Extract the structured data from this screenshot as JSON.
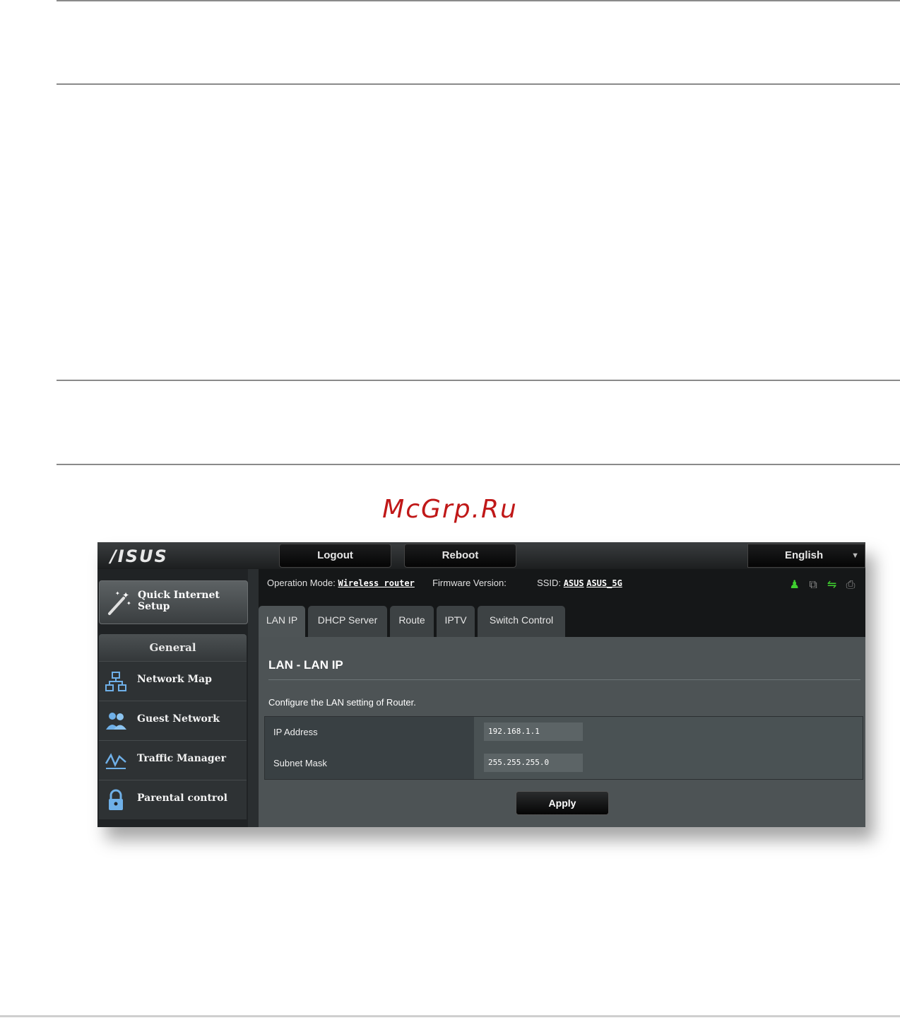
{
  "watermark": "McGrp.Ru",
  "router": {
    "logo": "/ISUS",
    "buttons": {
      "logout": "Logout",
      "reboot": "Reboot"
    },
    "language": "English",
    "sidebar": {
      "quick_setup": "Quick Internet Setup",
      "section": "General",
      "items": [
        {
          "label": "Network Map",
          "icon": "network-map-icon"
        },
        {
          "label": "Guest Network",
          "icon": "guest-network-icon"
        },
        {
          "label": "Traffic Manager",
          "icon": "traffic-manager-icon"
        },
        {
          "label": "Parental control",
          "icon": "lock-icon"
        }
      ]
    },
    "status": {
      "operation_mode_label": "Operation Mode:",
      "operation_mode_value": "Wireless router",
      "firmware_label": "Firmware Version:",
      "ssid_label": "SSID:",
      "ssid_1": "ASUS",
      "ssid_2": "ASUS_5G"
    },
    "tabs": [
      "LAN IP",
      "DHCP Server",
      "Route",
      "IPTV",
      "Switch Control"
    ],
    "panel": {
      "title": "LAN - LAN IP",
      "description": "Configure the LAN setting of Router.",
      "fields": [
        {
          "label": "IP Address",
          "value": "192.168.1.1"
        },
        {
          "label": "Subnet Mask",
          "value": "255.255.255.0"
        }
      ],
      "apply": "Apply"
    },
    "colors": {
      "accent_green": "#3fcf2f",
      "panel_bg": "#4d5355"
    }
  }
}
